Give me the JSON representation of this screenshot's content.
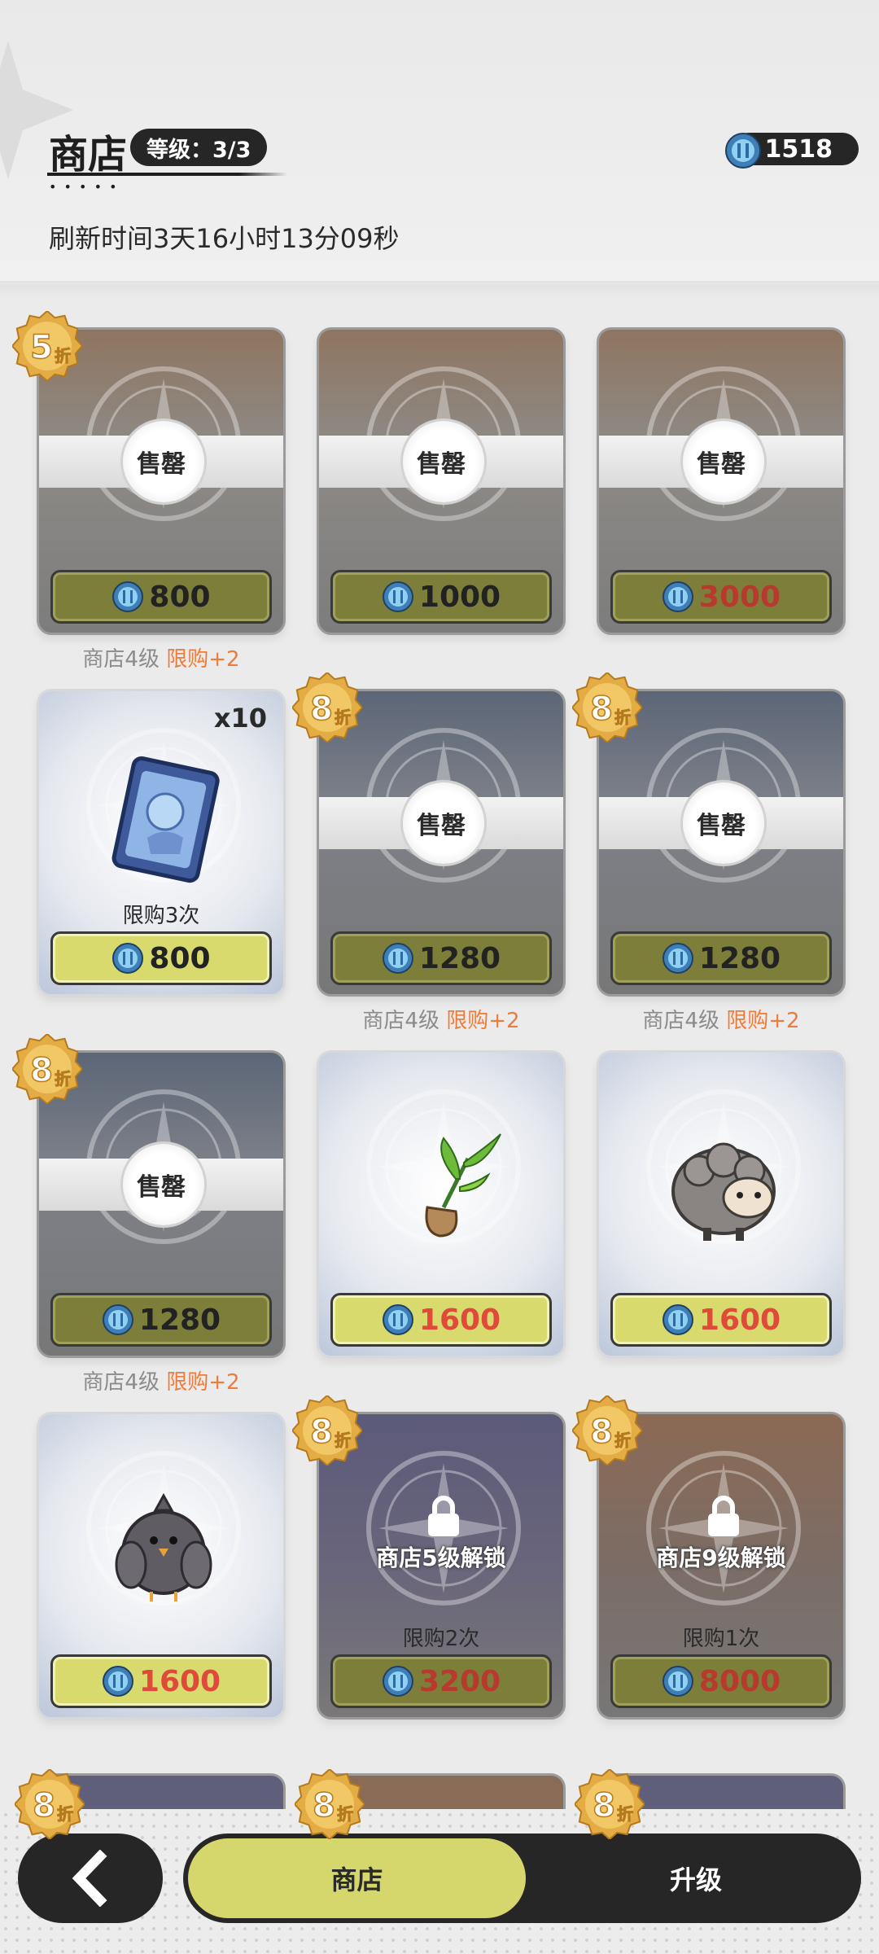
{
  "header": {
    "title": "商店",
    "level_badge": "等级：3/3",
    "currency_amount": "1518",
    "refresh_text": "刷新时间3天16小时13分09秒"
  },
  "labels": {
    "sold": "售罄"
  },
  "items": [
    {
      "state": "sold",
      "bg": "sold-brown",
      "discount": "5",
      "price": "800",
      "price_red": false,
      "note_gray": "商店4级",
      "note_orange": "限购+2"
    },
    {
      "state": "sold",
      "bg": "sold-brown",
      "discount": "",
      "price": "1000",
      "price_red": false,
      "note_gray": "",
      "note_orange": ""
    },
    {
      "state": "sold",
      "bg": "sold-brown",
      "discount": "",
      "price": "3000",
      "price_red": true,
      "note_gray": "",
      "note_orange": ""
    },
    {
      "state": "available",
      "bg": "light",
      "art": "card-icon",
      "quantity": "x10",
      "limit": "限购3次",
      "discount": "",
      "price": "800",
      "price_red": false,
      "note_gray": "",
      "note_orange": ""
    },
    {
      "state": "sold",
      "bg": "sold-slate",
      "discount": "8",
      "price": "1280",
      "price_red": false,
      "note_gray": "商店4级",
      "note_orange": "限购+2"
    },
    {
      "state": "sold",
      "bg": "sold-slate",
      "discount": "8",
      "price": "1280",
      "price_red": false,
      "note_gray": "商店4级",
      "note_orange": "限购+2"
    },
    {
      "state": "sold",
      "bg": "sold-slate",
      "discount": "8",
      "price": "1280",
      "price_red": false,
      "note_gray": "商店4级",
      "note_orange": "限购+2"
    },
    {
      "state": "available",
      "bg": "light",
      "art": "sapling-icon",
      "discount": "",
      "price": "1600",
      "price_red": true,
      "note_gray": "",
      "note_orange": ""
    },
    {
      "state": "available",
      "bg": "light",
      "art": "sheep-icon",
      "discount": "",
      "price": "1600",
      "price_red": true,
      "note_gray": "",
      "note_orange": ""
    },
    {
      "state": "available",
      "bg": "light",
      "art": "bird-icon",
      "discount": "",
      "price": "1600",
      "price_red": true,
      "note_gray": "",
      "note_orange": ""
    },
    {
      "state": "locked",
      "bg": "locked-purple",
      "discount": "8",
      "lock_text": "商店5级解锁",
      "limit": "限购2次",
      "price": "3200",
      "price_red": true,
      "note_gray": "",
      "note_orange": ""
    },
    {
      "state": "locked",
      "bg": "locked-brown",
      "discount": "8",
      "lock_text": "商店9级解锁",
      "limit": "限购1次",
      "price": "8000",
      "price_red": true,
      "note_gray": "",
      "note_orange": ""
    }
  ],
  "partial_row": [
    {
      "discount": "8"
    },
    {
      "discount": "8"
    },
    {
      "discount": "8"
    }
  ],
  "discount_suffix": "折",
  "bottom_nav": {
    "tab_shop": "商店",
    "tab_upgrade": "升级"
  },
  "colors": {
    "accent": "#d5d66c",
    "dark": "#262626",
    "price_red": "#e04a3a",
    "note_orange": "#ef7b3a"
  }
}
